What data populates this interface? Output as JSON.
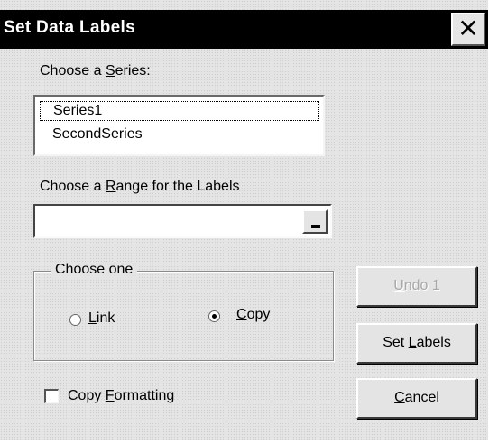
{
  "dialog": {
    "title": "Set Data Labels",
    "close_glyph": "✕"
  },
  "series": {
    "label_pre": "Choose a ",
    "label_key": "S",
    "label_post": "eries:",
    "items": [
      "Series1",
      "SecondSeries"
    ],
    "focused_index": 0
  },
  "range": {
    "label_pre": "Choose a ",
    "label_key": "R",
    "label_post": "ange for the Labels",
    "value": ""
  },
  "choose_one": {
    "legend": "Choose one",
    "link": {
      "key": "L",
      "rest": "ink",
      "checked": false
    },
    "copy": {
      "key": "C",
      "rest": "opy",
      "checked": true
    }
  },
  "copy_formatting": {
    "pre": "Copy ",
    "key": "F",
    "post": "ormatting",
    "checked": false
  },
  "buttons": {
    "undo": {
      "key": "U",
      "rest": "ndo 1",
      "disabled": true
    },
    "set_labels": {
      "pre": "Set ",
      "key": "L",
      "post": "abels"
    },
    "cancel": {
      "key": "C",
      "rest": "ancel"
    }
  }
}
